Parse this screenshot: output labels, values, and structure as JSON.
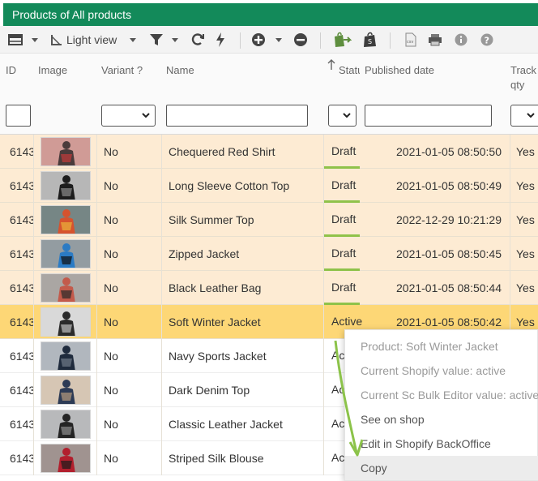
{
  "window": {
    "title": "Products of All products"
  },
  "toolbar": {
    "view_label": "Light view",
    "icons": [
      "grid-icon",
      "tree-view-icon",
      "filter-icon",
      "refresh-icon",
      "lightning-icon",
      "add-icon",
      "remove-icon",
      "shopify-sync-icon",
      "shopify-bag-icon",
      "csv-icon",
      "print-icon",
      "info-icon",
      "help-icon"
    ]
  },
  "columns": {
    "id": "ID",
    "image": "Image",
    "variant": "Variant ?",
    "name": "Name",
    "status": "Statu",
    "published": "Published date",
    "track_qty": "Track qty"
  },
  "rows": [
    {
      "id": "6143",
      "variant": "No",
      "name": "Chequered Red Shirt",
      "status": "Draft",
      "published": "2021-01-05 08:50:50",
      "track": "Yes",
      "state": "draft",
      "thumb_colors": [
        "#4a3b3b",
        "#c23a3a",
        "#d8cfc8"
      ]
    },
    {
      "id": "6143",
      "variant": "No",
      "name": "Long Sleeve Cotton Top",
      "status": "Draft",
      "published": "2021-01-05 08:50:49",
      "track": "Yes",
      "state": "draft",
      "thumb_colors": [
        "#1d1d1d",
        "#8a8a8a",
        "#cfcfcf"
      ]
    },
    {
      "id": "6143",
      "variant": "No",
      "name": "Silk Summer Top",
      "status": "Draft",
      "published": "2022-12-29 10:21:29",
      "track": "Yes",
      "state": "draft",
      "thumb_colors": [
        "#d6532e",
        "#e9b23a",
        "#3a6fae"
      ]
    },
    {
      "id": "6143",
      "variant": "No",
      "name": "Zipped Jacket",
      "status": "Draft",
      "published": "2021-01-05 08:50:45",
      "track": "Yes",
      "state": "draft",
      "thumb_colors": [
        "#2b7bc4",
        "#111111",
        "#d9e6ee"
      ]
    },
    {
      "id": "6143",
      "variant": "No",
      "name": "Black Leather Bag",
      "status": "Draft",
      "published": "2021-01-05 08:50:44",
      "track": "Yes",
      "state": "draft",
      "thumb_colors": [
        "#c35a4b",
        "#2a2a2a",
        "#efe9e4"
      ]
    },
    {
      "id": "6143",
      "variant": "No",
      "name": "Soft Winter Jacket",
      "status": "Active",
      "published": "2021-01-05 08:50:42",
      "track": "Yes",
      "state": "selected",
      "thumb_colors": [
        "#2b2b2b",
        "#bfbfbf",
        "#e6e6e6"
      ]
    },
    {
      "id": "6143",
      "variant": "No",
      "name": "Navy Sports Jacket",
      "status": "Acti",
      "published": "",
      "track": "",
      "state": "normal",
      "thumb_colors": [
        "#1f2b3d",
        "#6f7a88",
        "#d4d8dc"
      ]
    },
    {
      "id": "6143",
      "variant": "No",
      "name": "Dark Denim Top",
      "status": "Acti",
      "published": "",
      "track": "",
      "state": "normal",
      "thumb_colors": [
        "#2d3b55",
        "#b79b7e",
        "#e6ddd2"
      ]
    },
    {
      "id": "6143",
      "variant": "No",
      "name": "Classic Leather Jacket",
      "status": "Acti",
      "published": "",
      "track": "",
      "state": "normal",
      "thumb_colors": [
        "#242424",
        "#8d8d8d",
        "#cfd2d4"
      ]
    },
    {
      "id": "6143",
      "variant": "No",
      "name": "Striped Silk Blouse",
      "status": "Acti",
      "published": "",
      "track": "",
      "state": "normal",
      "thumb_colors": [
        "#b21f2d",
        "#1b1b1b",
        "#e8d5cf"
      ]
    }
  ],
  "context_menu": {
    "items": [
      {
        "label": "Product: Soft Winter Jacket",
        "enabled": false
      },
      {
        "label": "Current Shopify value: active",
        "enabled": false
      },
      {
        "label": "Current Sc Bulk Editor value: active",
        "enabled": false
      },
      {
        "label": "See on shop",
        "enabled": true
      },
      {
        "label": "Edit in Shopify BackOffice",
        "enabled": true
      },
      {
        "label": "Copy",
        "enabled": true,
        "hover": true
      }
    ]
  },
  "colors": {
    "title_bar": "#138a5a",
    "draft_row": "#fdebd3",
    "selected_row": "#fdd776",
    "status_underline": "#8fc24a",
    "annotation_arrow": "#8cc34a"
  }
}
